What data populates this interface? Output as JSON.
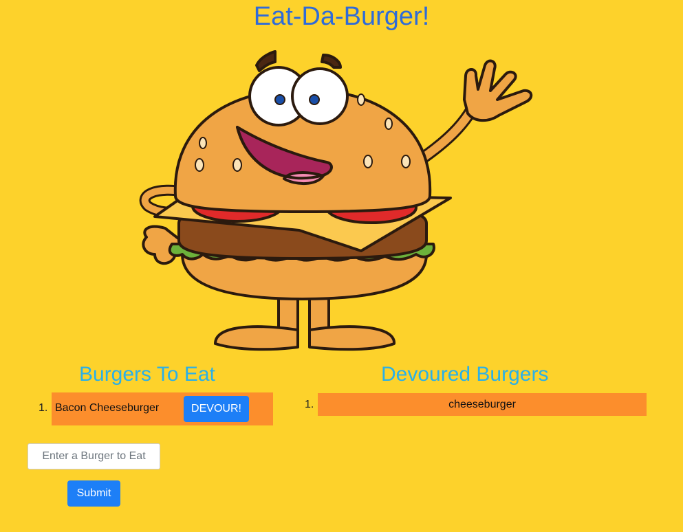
{
  "page": {
    "title": "Eat-Da-Burger!",
    "accent_color": "#2e6bd9",
    "background_color": "#fdd22b"
  },
  "mascot": {
    "icon": "burger-mascot-icon"
  },
  "to_eat": {
    "heading": "Burgers To Eat",
    "items": [
      {
        "number": "1.",
        "name": "Bacon Cheeseburger",
        "button_label": "DEVOUR!"
      }
    ]
  },
  "devoured": {
    "heading": "Devoured Burgers",
    "items": [
      {
        "number": "1.",
        "name": "cheeseburger"
      }
    ]
  },
  "form": {
    "input_placeholder": "Enter a Burger to Eat",
    "input_value": "",
    "submit_label": "Submit"
  }
}
